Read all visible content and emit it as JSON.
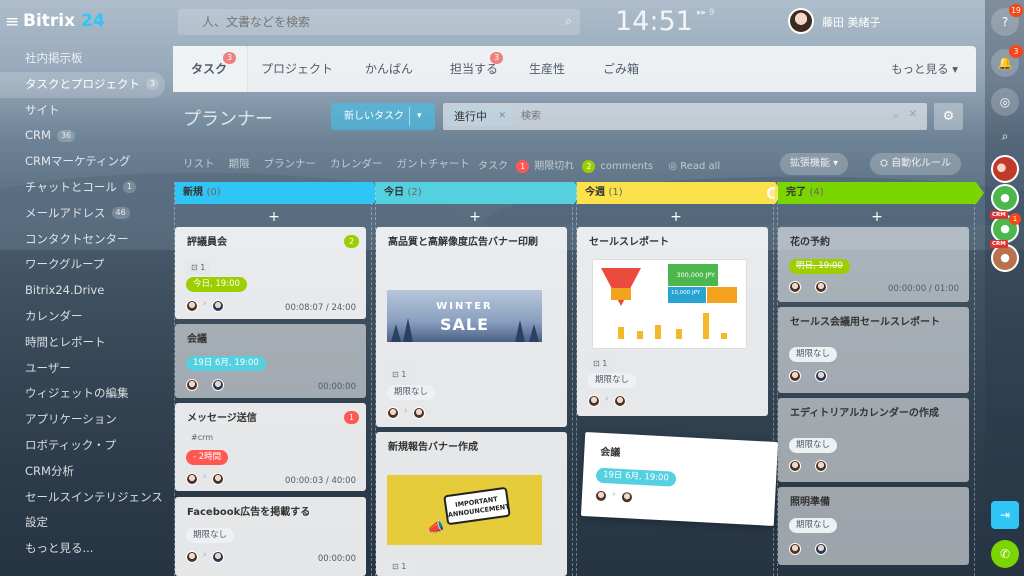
{
  "app": {
    "logo_main": "Bitrix",
    "logo_suffix": "24",
    "search_placeholder": "人、文書などを検索",
    "clock": "14:51",
    "clock_info": "▸▸ 9",
    "user_name": "藤田 美緒子"
  },
  "left_menu": [
    {
      "label": "社内掲示板",
      "count": ""
    },
    {
      "label": "タスクとプロジェクト",
      "count": "3"
    },
    {
      "label": "サイト",
      "count": ""
    },
    {
      "label": "CRM",
      "count": "36"
    },
    {
      "label": "CRMマーケティング",
      "count": ""
    },
    {
      "label": "チャットとコール",
      "count": "1"
    },
    {
      "label": "メールアドレス",
      "count": "46"
    },
    {
      "label": "コンタクトセンター",
      "count": ""
    },
    {
      "label": "ワークグループ",
      "count": ""
    },
    {
      "label": "Bitrix24.Drive",
      "count": ""
    },
    {
      "label": "カレンダー",
      "count": ""
    },
    {
      "label": "時間とレポート",
      "count": ""
    },
    {
      "label": "ユーザー",
      "count": ""
    },
    {
      "label": "ウィジェットの編集",
      "count": ""
    },
    {
      "label": "アプリケーション",
      "count": ""
    },
    {
      "label": "ロボティック・プ",
      "count": ""
    },
    {
      "label": "CRM分析",
      "count": ""
    },
    {
      "label": "セールスインテリジェンス",
      "count": ""
    },
    {
      "label": "設定",
      "count": ""
    },
    {
      "label": "もっと見る...",
      "count": ""
    }
  ],
  "tabs": [
    {
      "label": "タスク",
      "badge": "3"
    },
    {
      "label": "プロジェクト",
      "badge": ""
    },
    {
      "label": "かんばん",
      "badge": ""
    },
    {
      "label": "担当する",
      "badge": "3"
    },
    {
      "label": "生産性",
      "badge": ""
    },
    {
      "label": "ごみ箱",
      "badge": ""
    }
  ],
  "more_label": "もっと見る",
  "page_title": "プランナー",
  "new_task_label": "新しいタスク",
  "filter": {
    "chip": "進行中",
    "placeholder": "検索"
  },
  "views": [
    "リスト",
    "期限",
    "プランナー",
    "カレンダー",
    "ガントチャート"
  ],
  "counters": {
    "tasks_label": "タスク",
    "overdue_count": "1",
    "overdue_label": "期限切れ",
    "comments_count": "2",
    "comments_label": "comments",
    "read_all": "Read all"
  },
  "ext_label": "拡張機能",
  "auto_rules_label": "自動化ルール",
  "columns": [
    {
      "title": "新規",
      "count": "(0)",
      "color": "#2fc6f6"
    },
    {
      "title": "今日",
      "count": "(2)",
      "color": "#55d0e0"
    },
    {
      "title": "今週",
      "count": "(1)",
      "color": "#fbe14a"
    },
    {
      "title": "完了",
      "count": "(4)",
      "color": "#7bd500"
    }
  ],
  "add_symbol": "+",
  "cards": {
    "c1": {
      "title": "評議員会",
      "count": "2",
      "tag": "1",
      "deadline": "今日, 19:00",
      "time": "00:08:07 / 24:00"
    },
    "c2": {
      "title": "会議",
      "deadline": "19日 6月, 19:00",
      "time": "00:00:00"
    },
    "c3": {
      "title": "メッセージ送信",
      "count": "1",
      "tag": "#crm",
      "deadline": "- 2時間",
      "time": "00:00:03 / 40:00"
    },
    "c4": {
      "title": "Facebook広告を掲載する",
      "deadline": "期限なし",
      "time": "00:00:00"
    },
    "t1": {
      "title": "高品質と高解像度広告バナー印刷",
      "tag": "1",
      "deadline": "期限なし",
      "img_top": "WINTER",
      "img_main": "SALE"
    },
    "t2": {
      "title": "新規報告バナー作成",
      "img_line1": "IMPORTANT",
      "img_line2": "ANNOUNCEMENT",
      "tag": "1"
    },
    "w1": {
      "title": "セールスレポート",
      "tag": "1",
      "deadline": "期限なし",
      "img_value1": "300,000 JPY",
      "img_value2": "10,000 JPY"
    },
    "w2": {
      "title": "会議",
      "deadline": "19日 6月, 19:00"
    },
    "d1": {
      "title": "花の予約",
      "deadline": "明日, 19:00",
      "time": "00:00:00 / 01:00"
    },
    "d2": {
      "title": "セールス会議用セールスレポート",
      "deadline": "期限なし"
    },
    "d3": {
      "title": "エディトリアルカレンダーの作成",
      "deadline": "期限なし"
    },
    "d4": {
      "title": "照明準備",
      "deadline": "期限なし"
    }
  },
  "right_bar": {
    "help_badge": "19",
    "bell_badge": "3",
    "crm_badge": "1",
    "crm_label": "CRM"
  },
  "colors": {
    "accent": "#2fc6f6",
    "today_green": "#9dcf00",
    "overdue": "#ff5752",
    "hold": "#55d0e0"
  }
}
